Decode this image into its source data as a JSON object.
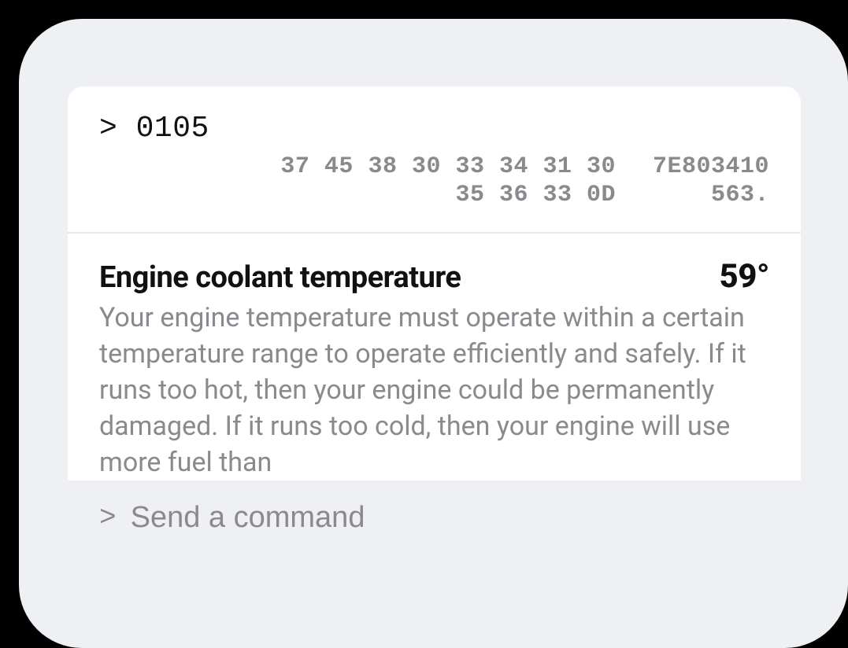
{
  "terminal": {
    "prompt": ">",
    "command": "0105",
    "hex": [
      {
        "bytes": "37 45 38 30 33 34 31 30",
        "ascii": "7E803410"
      },
      {
        "bytes": "35 36 33 0D",
        "ascii": "563."
      }
    ]
  },
  "reading": {
    "title": "Engine coolant temperature",
    "value": "59°",
    "description": "Your engine temperature must operate within a certain temperature range to operate efficiently and safely. If it runs too hot, then your engine could be permanently damaged. If it runs too cold, then your engine will use more fuel than"
  },
  "input": {
    "prompt": ">",
    "placeholder": "Send a command"
  }
}
